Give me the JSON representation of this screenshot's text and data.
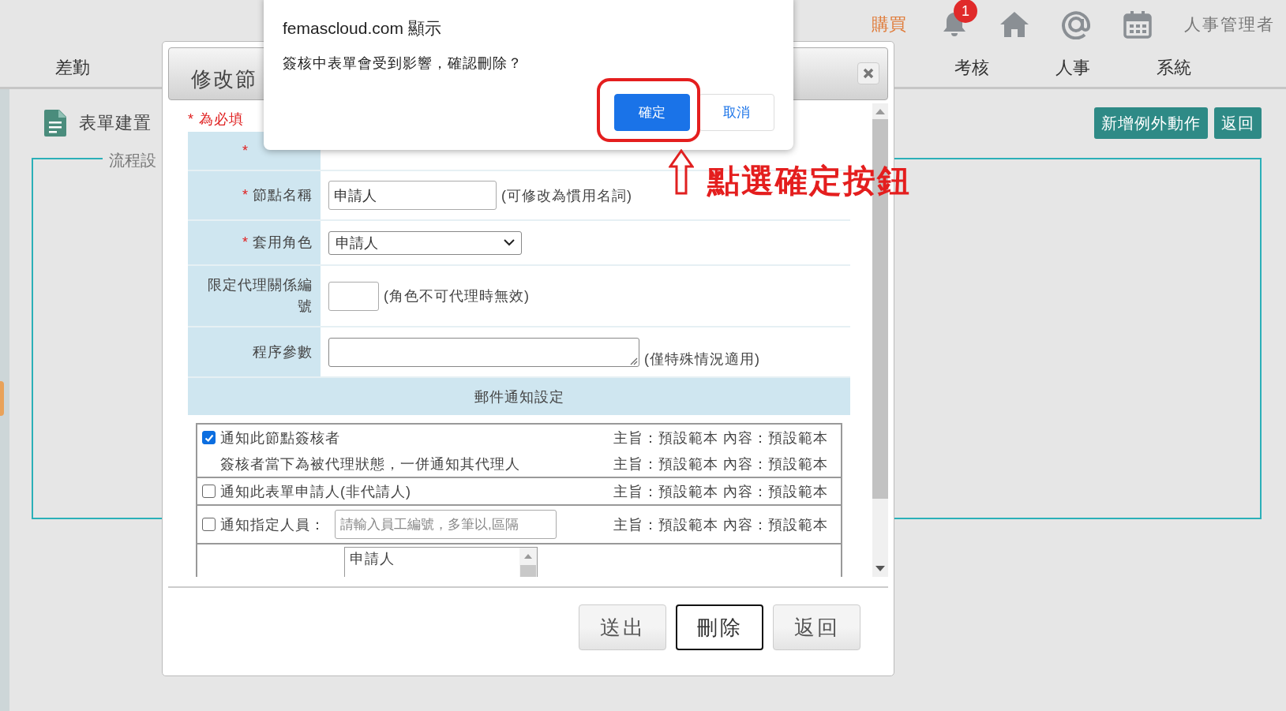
{
  "header": {
    "buy_link": "購買",
    "notification_count": "1",
    "user": "人事管理者"
  },
  "nav": [
    {
      "label": "差勤"
    },
    {
      "label": "考核"
    },
    {
      "label": "人事"
    },
    {
      "label": "系統"
    }
  ],
  "page": {
    "title": "表單建置",
    "buttons": [
      "新增例外動作",
      "返回"
    ],
    "fieldset_legend": "流程設"
  },
  "modal": {
    "title": "修改節",
    "required_note": "* 為必填",
    "rows": [
      {
        "kind": "text",
        "marker": "*"
      },
      {
        "kind": "input",
        "label": "節點名稱",
        "marker": "*",
        "value": "申請人",
        "hint": "(可修改為慣用名詞)"
      },
      {
        "kind": "select",
        "label": "套用角色",
        "marker": "*",
        "value": "申請人"
      },
      {
        "kind": "small_input",
        "label": "限定代理關係編號",
        "hint": "(角色不可代理時無效)"
      },
      {
        "kind": "textarea",
        "label": "程序參數",
        "hint": "(僅特殊情況適用)"
      }
    ],
    "mail_section_title": "郵件通知設定",
    "notifications": [
      {
        "kind": "checkbox",
        "checked": true,
        "label": "通知此節點簽核者",
        "template": "主旨：預設範本 內容：預設範本"
      },
      {
        "kind": "sub",
        "label": "簽核者當下為被代理狀態，一併通知其代理人",
        "template": "主旨：預設範本 內容：預設範本"
      },
      {
        "kind": "checkbox",
        "checked": false,
        "label": "通知此表單申請人(非代請人)",
        "template": "主旨：預設範本 內容：預設範本"
      },
      {
        "kind": "checkbox_input",
        "checked": false,
        "label": "通知指定人員：",
        "placeholder": "請輸入員工編號，多筆以,區隔",
        "template": "主旨：預設範本 內容：預設範本"
      },
      {
        "kind": "listbox",
        "items": [
          "申請人"
        ]
      }
    ],
    "buttons": [
      {
        "label": "送出",
        "focused": false
      },
      {
        "label": "刪除",
        "focused": true
      },
      {
        "label": "返回",
        "focused": false
      }
    ]
  },
  "alert": {
    "origin": "femascloud.com 顯示",
    "message": "簽核中表單會受到影響，確認刪除？",
    "buttons": [
      {
        "label": "確定",
        "primary": true
      },
      {
        "label": "取消",
        "primary": false
      }
    ]
  },
  "annotation": {
    "text": "點選確定按鈕"
  }
}
